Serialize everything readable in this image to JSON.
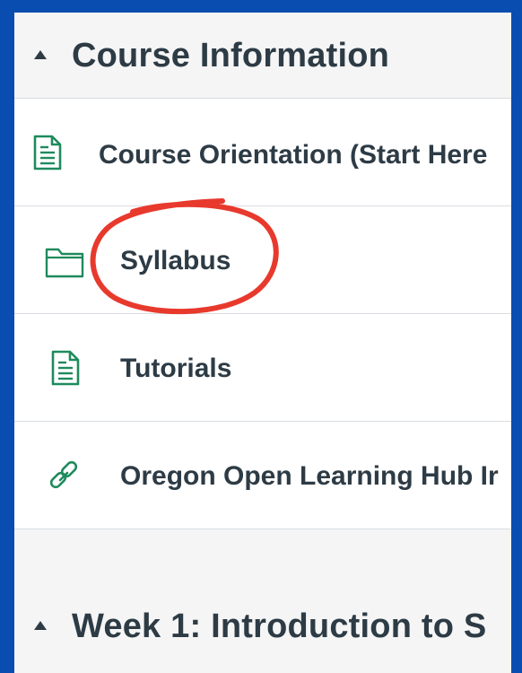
{
  "modules": [
    {
      "title": "Course Information",
      "items": [
        {
          "label": "Course Orientation (Start Here",
          "icon": "page-icon"
        },
        {
          "label": "Syllabus",
          "icon": "folder-icon"
        },
        {
          "label": "Tutorials",
          "icon": "page-icon"
        },
        {
          "label": "Oregon Open Learning Hub Ir",
          "icon": "link-icon"
        }
      ]
    },
    {
      "title": "Week 1:  Introduction to S"
    }
  ],
  "colors": {
    "background": "#0a4db0",
    "text": "#2d3b45",
    "icon": "#1f8a5c",
    "annotation": "#e8392d"
  }
}
